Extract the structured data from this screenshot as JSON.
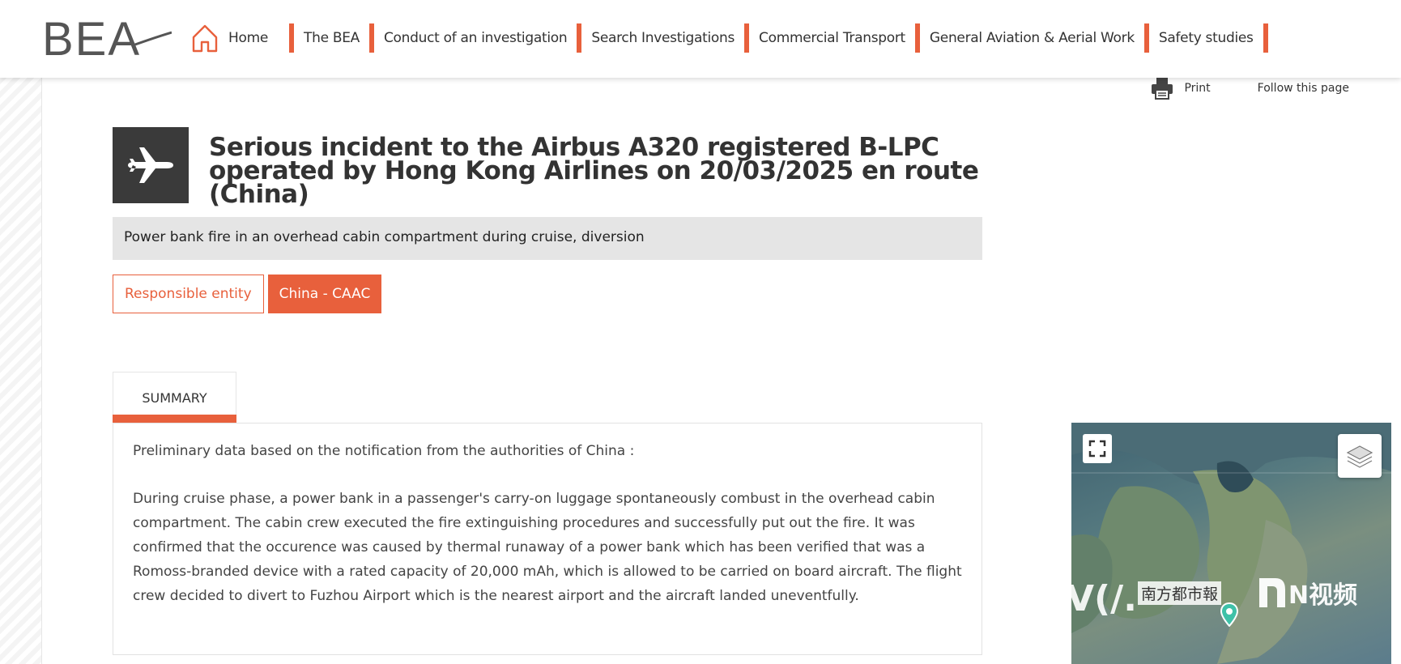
{
  "header": {
    "logo_text": "BEA",
    "nav": [
      {
        "label": "Home"
      },
      {
        "label": "The BEA"
      },
      {
        "label": "Conduct of an investigation"
      },
      {
        "label": "Search Investigations"
      },
      {
        "label": "Commercial Transport"
      },
      {
        "label": "General Aviation & Aerial Work"
      },
      {
        "label": "Safety studies"
      }
    ]
  },
  "toolbar": {
    "print_label": "Print",
    "follow_label": "Follow this page"
  },
  "page": {
    "icon": "airplane-icon",
    "title": "Serious incident to the Airbus A320 registered B-LPC operated by Hong Kong Airlines on 20/03/2025 en route (China)",
    "subtitle": "Power bank fire in an overhead cabin compartment during cruise, diversion",
    "entity_label": "Responsible entity",
    "entity_value": "China - CAAC"
  },
  "tabs": [
    {
      "label": "SUMMARY",
      "active": true
    }
  ],
  "summary": {
    "intro": "Preliminary data based on the notification from the authorities of China :",
    "body": "During cruise phase, a power bank in a passenger's carry-on luggage spontaneously combust in the overhead cabin compartment. The cabin crew executed the fire extinguishing procedures and successfully put out the fire. It was confirmed that the occurence was caused by thermal runaway of a power bank which has been verified that was a Romoss-branded device with a rated capacity of 20,000 mAh, which is allowed to be carried on board aircraft. The flight crew decided to divert to Fuzhou Airport which is the nearest airport and the aircraft landed uneventfully."
  },
  "map": {
    "watermark_left": "V(/.",
    "watermark_center": "南方都市報",
    "watermark_right": "N视频"
  },
  "colors": {
    "accent": "#e8603c",
    "dark_box": "#3a3a3a",
    "subtitle_bg": "#e5e5e5"
  }
}
